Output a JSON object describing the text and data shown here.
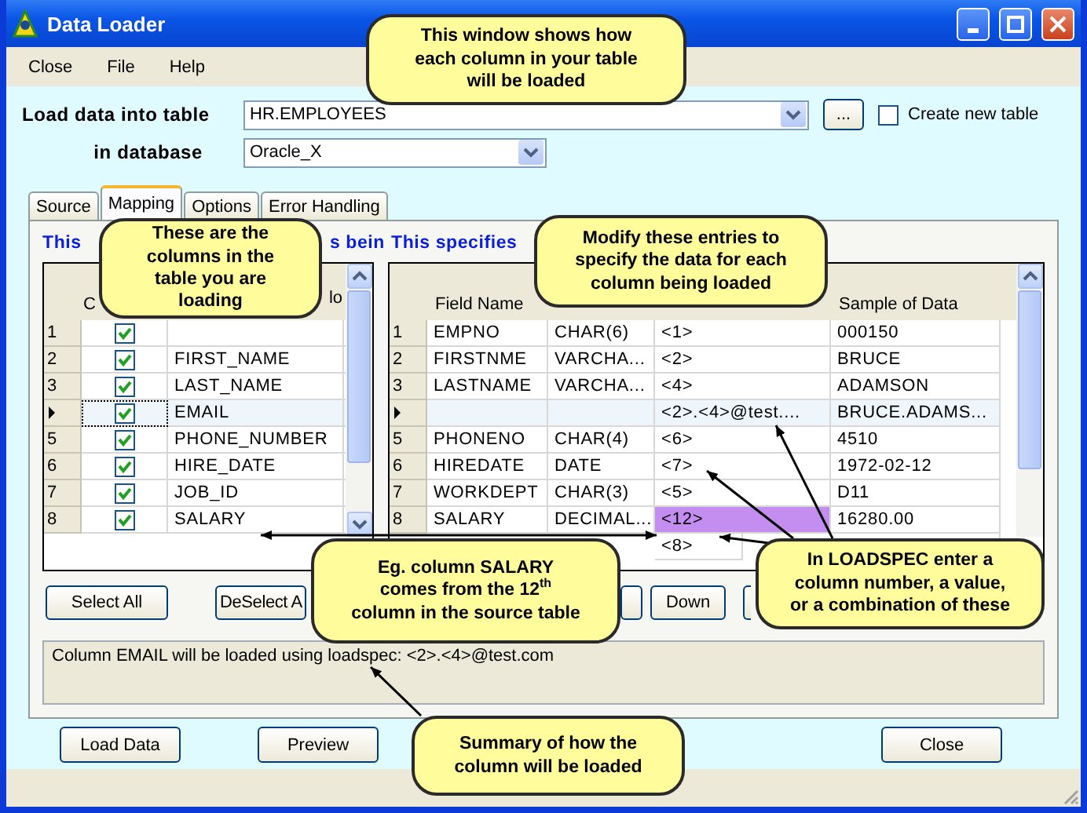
{
  "window": {
    "title": "Data Loader"
  },
  "menu": [
    "Close",
    "File",
    "Help"
  ],
  "load_table": {
    "label": "Load data into table",
    "value": "HR.EMPLOYEES",
    "browse": "...",
    "create_new": {
      "label": "Create new table",
      "checked": false
    }
  },
  "database": {
    "label": "in database",
    "value": "Oracle_X"
  },
  "tabs": [
    {
      "label": "Source",
      "selected": false
    },
    {
      "label": "Mapping",
      "selected": true
    },
    {
      "label": "Options",
      "selected": false
    },
    {
      "label": "Error Handling",
      "selected": false
    }
  ],
  "left_heading": [
    "This",
    "s bein"
  ],
  "right_heading": "This specifies",
  "left_grid": {
    "columns": [
      "C",
      "lo"
    ],
    "rows": [
      {
        "num": "1",
        "checked": true,
        "current": false
      },
      {
        "num": "2",
        "checked": true,
        "name": "FIRST_NAME",
        "current": false
      },
      {
        "num": "3",
        "checked": true,
        "name": "LAST_NAME",
        "current": false
      },
      {
        "checked": true,
        "name": "EMAIL",
        "current": true
      },
      {
        "num": "5",
        "checked": true,
        "name": "PHONE_NUMBER",
        "current": false
      },
      {
        "num": "6",
        "checked": true,
        "name": "HIRE_DATE",
        "current": false
      },
      {
        "num": "7",
        "checked": true,
        "name": "JOB_ID",
        "current": false
      },
      {
        "num": "8",
        "checked": true,
        "name": "SALARY",
        "current": false
      }
    ]
  },
  "right_grid": {
    "columns": [
      "Field Name",
      "Sample of Data"
    ],
    "rows": [
      {
        "num": "1",
        "field": "EMPNO",
        "type": "CHAR(6)",
        "loadspec": "<1>",
        "sample": "000150",
        "current": false,
        "highlighted": false
      },
      {
        "num": "2",
        "field": "FIRSTNME",
        "type": "VARCHA...",
        "loadspec": "<2>",
        "sample": "BRUCE",
        "current": false,
        "highlighted": false
      },
      {
        "num": "3",
        "field": "LASTNAME",
        "type": "VARCHA...",
        "loadspec": "<4>",
        "sample": "ADAMSON",
        "current": false,
        "highlighted": false
      },
      {
        "loadspec": "<2>.<4>@test....",
        "sample": "BRUCE.ADAMS...",
        "current": true,
        "highlighted": false
      },
      {
        "num": "5",
        "field": "PHONENO",
        "type": "CHAR(4)",
        "loadspec": "<6>",
        "sample": "4510",
        "current": false,
        "highlighted": false
      },
      {
        "num": "6",
        "field": "HIREDATE",
        "type": "DATE",
        "loadspec": "<7>",
        "sample": "1972-02-12",
        "current": false,
        "highlighted": false
      },
      {
        "num": "7",
        "field": "WORKDEPT",
        "type": "CHAR(3)",
        "loadspec": "<5>",
        "sample": "D11",
        "current": false,
        "highlighted": false
      },
      {
        "num": "8",
        "field": "SALARY",
        "type": "DECIMAL...",
        "loadspec": "<12>",
        "sample": "16280.00",
        "current": false,
        "highlighted": true
      },
      {
        "loadspec": "<8>",
        "current": false,
        "highlighted": false
      }
    ]
  },
  "panel_buttons": [
    {
      "kind": "button",
      "label": "Select All"
    },
    {
      "kind": "button",
      "label": "DeSelect A"
    },
    {
      "kind": "covered"
    },
    {
      "kind": "button",
      "label": "Down"
    },
    {
      "kind": "covered"
    }
  ],
  "summary": "Column EMAIL will be loaded using loadspec: <2>.<4>@test.com",
  "bottom_buttons": [
    {
      "label": "Load Data"
    },
    {
      "label": "Preview"
    },
    {
      "label": "Close"
    }
  ],
  "callouts": [
    {
      "text": "This window shows how\neach column in your table\nwill be loaded",
      "kind": "top"
    },
    {
      "text": "These are the\ncolumns in the\ntable you are\nloading",
      "kind": "columns"
    },
    {
      "text": "Modify these entries to\nspecify the data for each\ncolumn being loaded",
      "kind": "modify"
    },
    {
      "text": "Eg. column SALARY\ncomes from the 12$^{th}$\ncolumn in the source table",
      "kind": "example"
    },
    {
      "text": "In LOADSPEC enter a\ncolumn number, a value,\nor a combination of these",
      "kind": "loadspec"
    },
    {
      "text": "Summary of how the\ncolumn will be loaded",
      "kind": "summary"
    }
  ]
}
